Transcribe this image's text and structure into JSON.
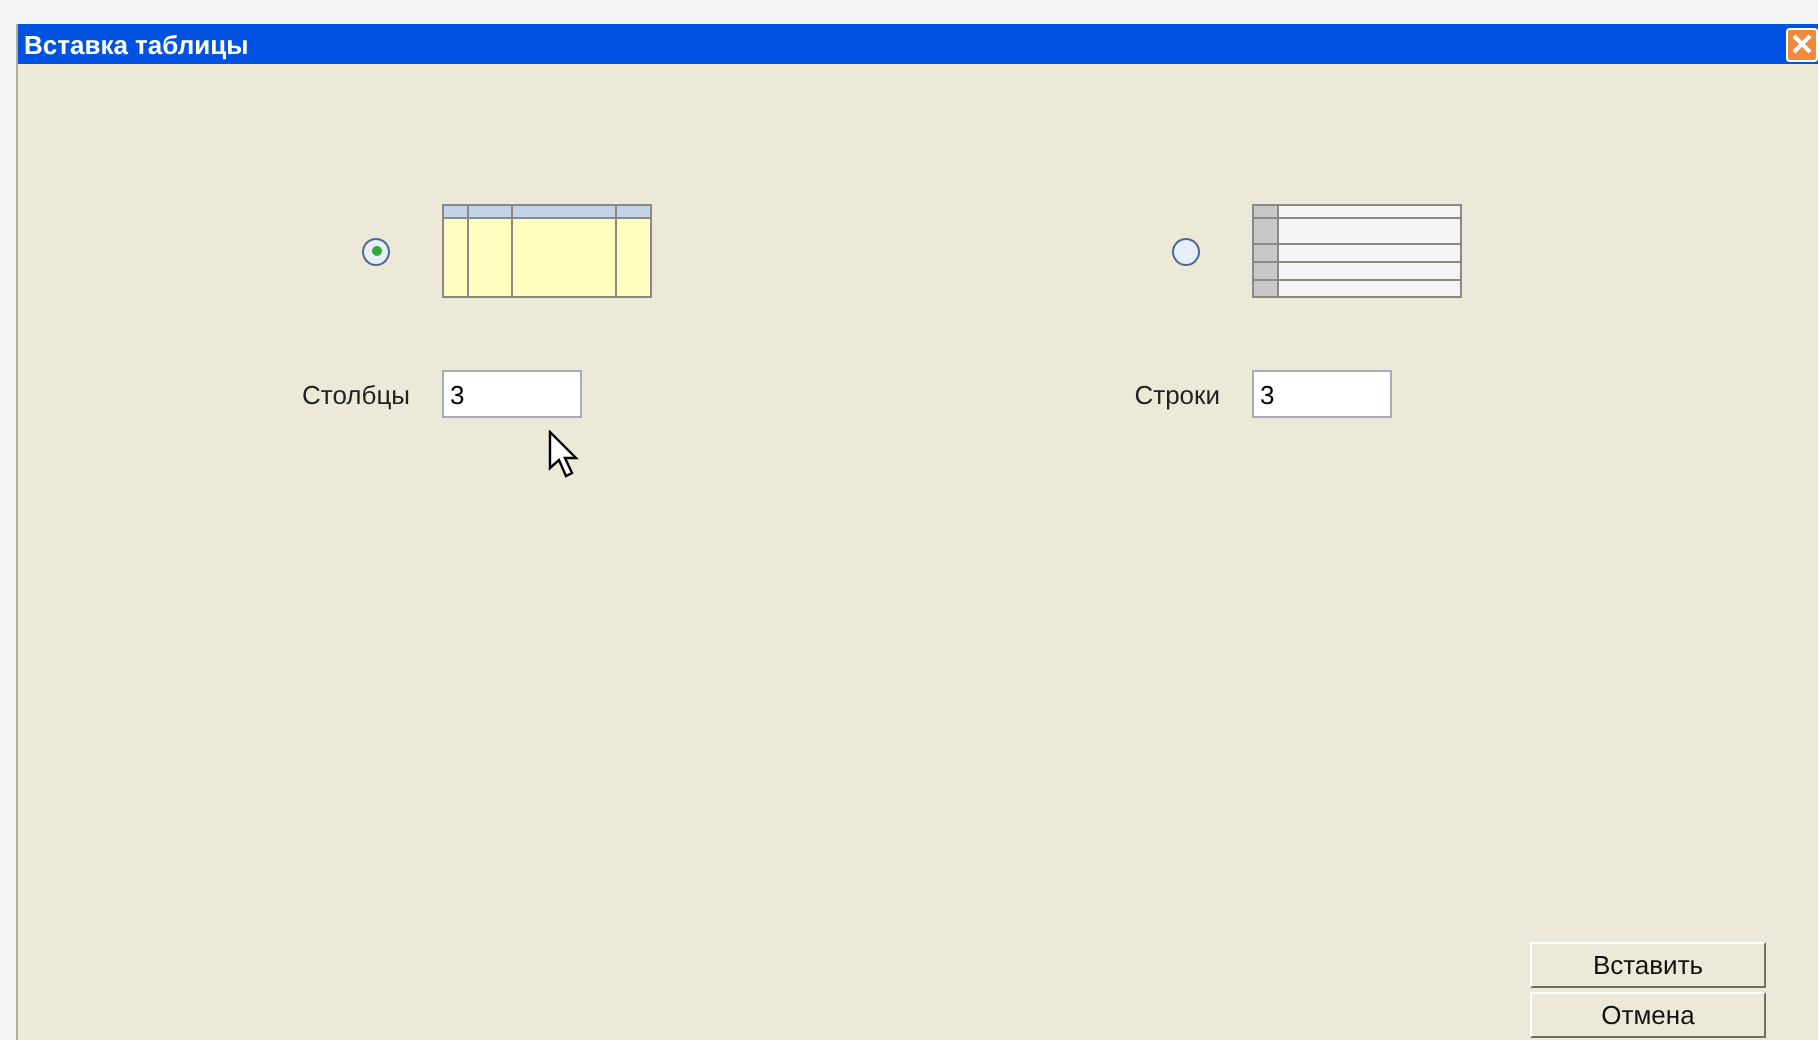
{
  "window": {
    "title": "Вставка таблицы"
  },
  "options": [
    {
      "kind": "columns",
      "selected": true,
      "label": "Столбцы",
      "value": "3"
    },
    {
      "kind": "rows",
      "selected": false,
      "label": "Строки",
      "value": "3"
    }
  ],
  "buttons": [
    "Вставить",
    "Отмена"
  ]
}
